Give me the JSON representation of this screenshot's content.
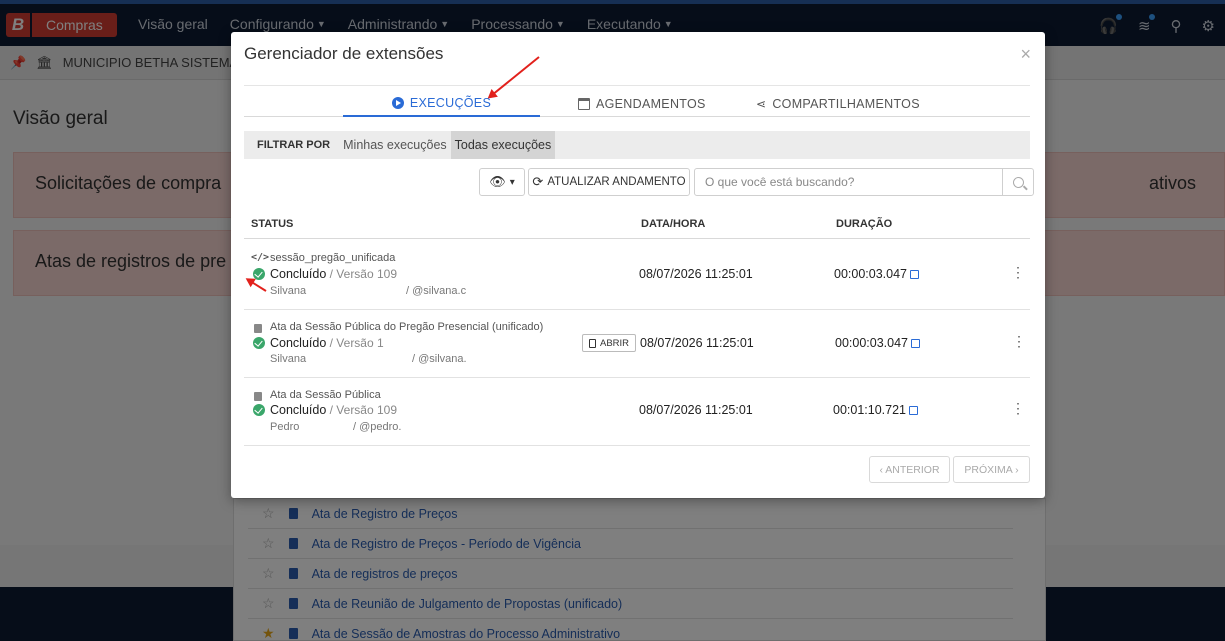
{
  "app": {
    "brand_letter": "B",
    "brand_name": "Compras",
    "nav": [
      "Visão geral",
      "Configurando",
      "Administrando",
      "Processando",
      "Executando"
    ],
    "entity": "MUNICIPIO BETHA SISTEMAS L",
    "page_title": "Visão geral",
    "cards": [
      {
        "left": "Solicitações de compra",
        "right": "ativos"
      },
      {
        "left": "Atas de registros de pre",
        "right": ""
      }
    ],
    "menu_items": [
      {
        "label": "Ata de Registro de Preços",
        "favorite": false
      },
      {
        "label": "Ata de Registro de Preços - Período de Vigência",
        "favorite": false
      },
      {
        "label": "Ata de registros de preços",
        "favorite": false
      },
      {
        "label": "Ata de Reunião de Julgamento de Propostas (unificado)",
        "favorite": false
      },
      {
        "label": "Ata de Sessão de Amostras do Processo Administrativo",
        "favorite": true
      }
    ]
  },
  "modal": {
    "title": "Gerenciador de extensões",
    "close": "×",
    "tabs": [
      {
        "label": "EXECUÇÕES",
        "icon": "play-circle-icon",
        "active": true
      },
      {
        "label": "AGENDAMENTOS",
        "icon": "calendar-icon",
        "active": false
      },
      {
        "label": "COMPARTILHAMENTOS",
        "icon": "share-icon",
        "active": false
      }
    ],
    "filter": {
      "label": "FILTRAR POR",
      "options": [
        "Minhas execuções",
        "Todas execuções"
      ],
      "selected": "Todas execuções"
    },
    "toolbar": {
      "eye_caret": "▾",
      "refresh_label": "ATUALIZAR ANDAMENTO",
      "search_placeholder": "O que você está buscando?"
    },
    "columns": {
      "status": "STATUS",
      "datetime": "DATA/HORA",
      "duration": "DURAÇÃO"
    },
    "rows": [
      {
        "name": "sessão_pregão_unificada",
        "type": "script",
        "status": "Concluído",
        "version": " / Versão 109",
        "user": "Silvana",
        "handle": "/ @silvana.c",
        "datetime": "08/07/2026 11:25:01",
        "duration": "00:00:03.047",
        "open_label": ""
      },
      {
        "name": "Ata da Sessão Pública do Pregão Presencial (unificado)",
        "type": "report",
        "status": "Concluído",
        "version": " / Versão 1",
        "user": "Silvana",
        "handle": "/ @silvana.",
        "datetime": "08/07/2026 11:25:01",
        "duration": "00:00:03.047",
        "open_label": "ABRIR"
      },
      {
        "name": "Ata da Sessão Pública",
        "type": "report",
        "status": "Concluído",
        "version": " / Versão 109",
        "user": "Pedro",
        "handle": "/ @pedro.",
        "datetime": "08/07/2026 11:25:01",
        "duration": "00:01:10.721",
        "open_label": ""
      }
    ],
    "pager": {
      "prev": "‹ ANTERIOR",
      "next": "PRÓXIMA ›"
    }
  },
  "colors": {
    "accent": "#2a6bd6",
    "success": "#3aa66a",
    "brand": "#d23c32",
    "annotation": "#e2211c"
  }
}
